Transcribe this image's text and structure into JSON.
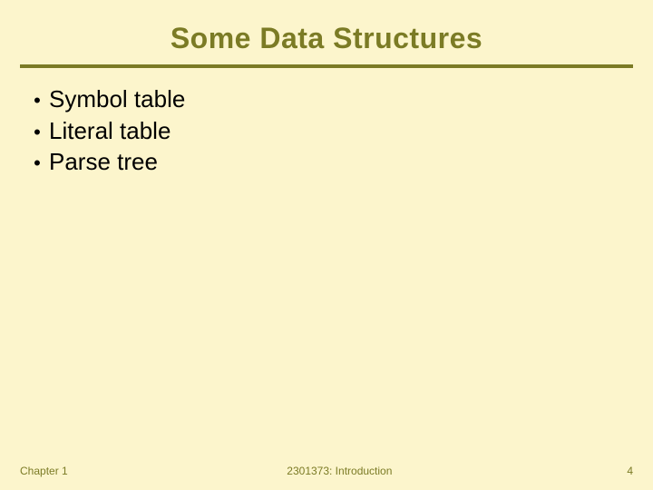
{
  "title": "Some Data Structures",
  "bullets": [
    "Symbol table",
    "Literal table",
    "Parse tree"
  ],
  "footer": {
    "left": "Chapter 1",
    "center": "2301373: Introduction",
    "right": "4"
  },
  "colors": {
    "background": "#fcf5cc",
    "accent": "#7b7b25",
    "text": "#000000"
  }
}
